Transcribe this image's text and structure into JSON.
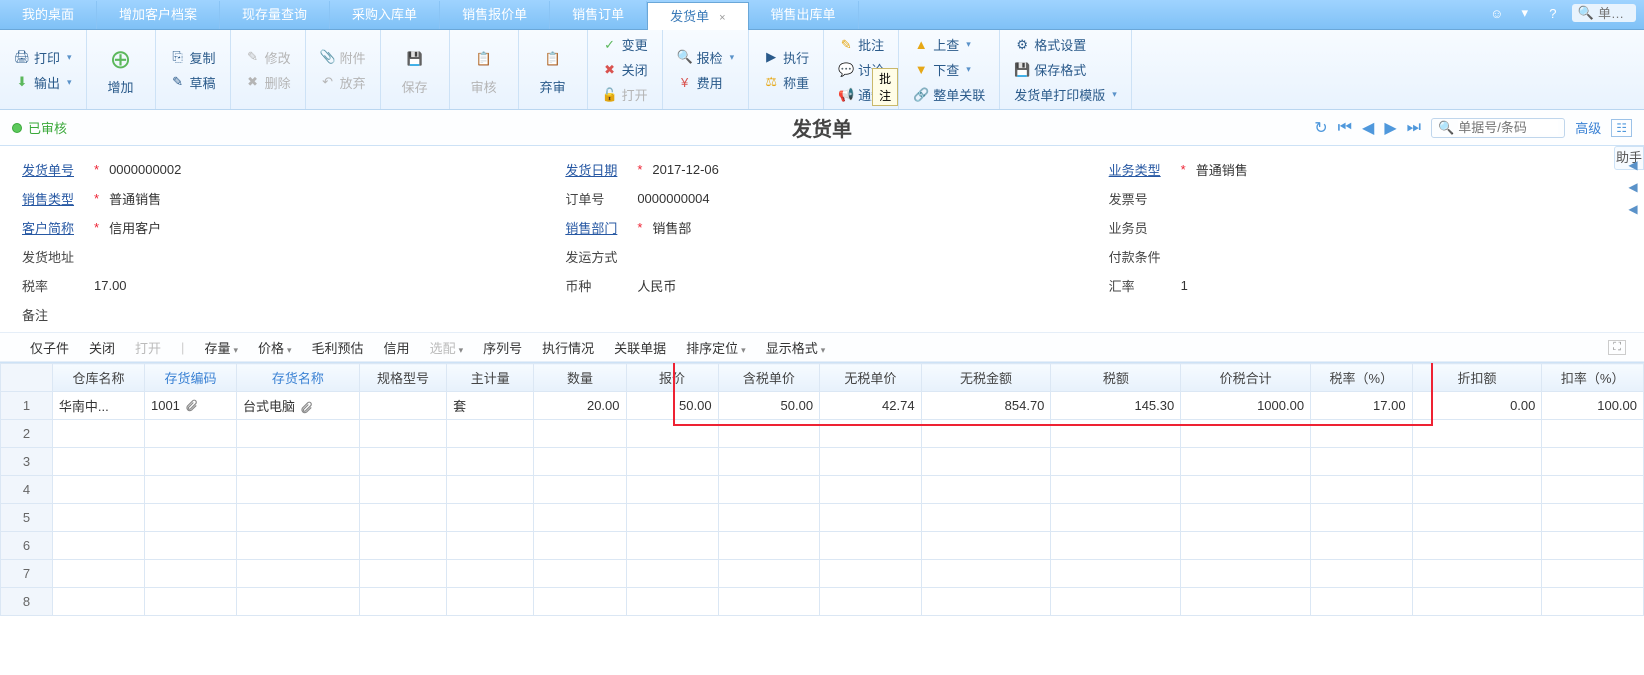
{
  "tabs": [
    "我的桌面",
    "增加客户档案",
    "现存量查询",
    "采购入库单",
    "销售报价单",
    "销售订单",
    "发货单",
    "销售出库单"
  ],
  "active_tab_index": 6,
  "top_search_placeholder": "单…",
  "ribbon": {
    "print": "打印",
    "export": "输出",
    "add": "增加",
    "copy": "复制",
    "modify": "修改",
    "attach": "附件",
    "draft": "草稿",
    "delete": "删除",
    "discard": "放弃",
    "save": "保存",
    "audit": "审核",
    "unaudit": "弃审",
    "change": "变更",
    "close": "关闭",
    "open": "打开",
    "inspect": "报检",
    "exec": "执行",
    "cost": "费用",
    "weigh": "称重",
    "note": "批注",
    "discuss": "讨论",
    "notify": "通知",
    "up": "上查",
    "down": "下查",
    "wholerel": "整单关联",
    "fmtset": "格式设置",
    "fmtsave": "保存格式",
    "printtpl": "发货单打印模版",
    "tooltip": "批注"
  },
  "status": "已审核",
  "doc_title": "发货单",
  "search_placeholder": "单据号/条码",
  "advanced": "高级",
  "assistant": "助手",
  "form": {
    "ship_no_label": "发货单号",
    "ship_no": "0000000002",
    "ship_date_label": "发货日期",
    "ship_date": "2017-12-06",
    "biz_type_label": "业务类型",
    "biz_type": "普通销售",
    "sale_type_label": "销售类型",
    "sale_type": "普通销售",
    "order_no_label": "订单号",
    "order_no": "0000000004",
    "invoice_no_label": "发票号",
    "invoice_no": "",
    "cust_label": "客户简称",
    "cust": "信用客户",
    "dept_label": "销售部门",
    "dept": "销售部",
    "clerk_label": "业务员",
    "clerk": "",
    "addr_label": "发货地址",
    "addr": "",
    "shipway_label": "发运方式",
    "shipway": "",
    "payterm_label": "付款条件",
    "payterm": "",
    "taxrate_label": "税率",
    "taxrate": "17.00",
    "currency_label": "币种",
    "currency": "人民币",
    "exrate_label": "汇率",
    "exrate": "1",
    "remark_label": "备注",
    "remark": ""
  },
  "subbar": {
    "only_child": "仅子件",
    "close": "关闭",
    "open": "打开",
    "stock": "存量",
    "price": "价格",
    "gross": "毛利预估",
    "credit": "信用",
    "pick": "选配",
    "seq": "序列号",
    "exec": "执行情况",
    "rel": "关联单据",
    "sort": "排序定位",
    "disp": "显示格式"
  },
  "grid": {
    "headers": [
      "",
      "仓库名称",
      "存货编码",
      "存货名称",
      "规格型号",
      "主计量",
      "数量",
      "报价",
      "含税单价",
      "无税单价",
      "无税金额",
      "税额",
      "价税合计",
      "税率（%）",
      "折扣额",
      "扣率（%）"
    ],
    "link_cols": [
      2,
      3
    ],
    "rows": [
      {
        "n": "1",
        "wh": "华南中...",
        "code": "1001",
        "name": "台式电脑",
        "spec": "",
        "uom": "套",
        "qty": "20.00",
        "quote": "50.00",
        "pincl": "50.00",
        "pexcl": "42.74",
        "amtexcl": "854.70",
        "tax": "145.30",
        "total": "1000.00",
        "trate": "17.00",
        "disc": "0.00",
        "drate": "100.00"
      }
    ],
    "empty_rows": 7
  }
}
